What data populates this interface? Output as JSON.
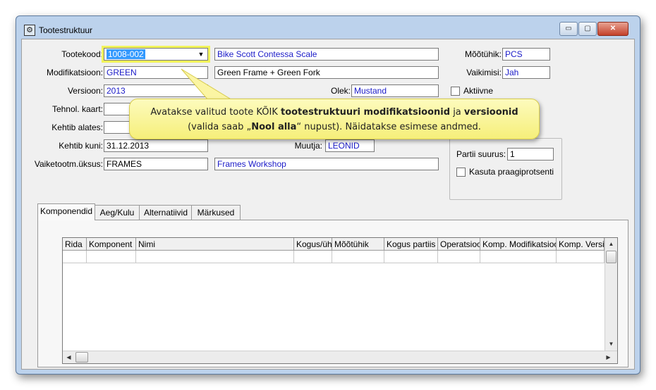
{
  "window": {
    "title": "Tootestruktuur",
    "buttons": {
      "minimize": "▭",
      "maximize": "▢",
      "close": "✕"
    }
  },
  "form": {
    "tootekood": {
      "label": "Tootekood:",
      "value": "1008-002",
      "description": "Bike Scott Contessa Scale"
    },
    "modifikatsioon": {
      "label": "Modifikatsioon:",
      "value": "GREEN",
      "description": "Green Frame + Green Fork"
    },
    "versioon": {
      "label": "Versioon:",
      "value": "2013"
    },
    "olek": {
      "label": "Olek:",
      "value": "Mustand"
    },
    "tehnol_kaart": {
      "label": "Tehnol. kaart:",
      "value": ""
    },
    "kehtib_alates": {
      "label": "Kehtib alates:",
      "value": ""
    },
    "kehtib_kuni": {
      "label": "Kehtib kuni:",
      "value": "31.12.2013"
    },
    "muutja": {
      "label": "Muutja:",
      "value": "LEONID"
    },
    "vaiketootm_uksus": {
      "label": "Vaiketootm.üksus:",
      "value": "FRAMES",
      "description": "Frames Workshop"
    },
    "mootuhik": {
      "label": "Mõõtühik:",
      "value": "PCS"
    },
    "vaikimisi": {
      "label": "Vaikimisi:",
      "value": "Jah"
    },
    "aktiivne": {
      "label": "Aktiivne",
      "checked": false
    },
    "partii_suurus": {
      "label": "Partii suurus:",
      "value": "1"
    },
    "kasuta_praagiprotsenti": {
      "label": "Kasuta praagiprotsenti",
      "checked": false
    }
  },
  "callout": {
    "line1_a": "Avatakse valitud toote KÕIK ",
    "line1_b": "tootestruktuuri modifikatsioonid",
    "line1_c": " ja ",
    "line1_d": "versioonid",
    "line2_a": "(valida saab  „",
    "line2_b": "Nool alla",
    "line2_c": "“ nupust). Näidatakse esimese andmed."
  },
  "tabs": [
    "Komponendid",
    "Aeg/Kulu",
    "Alternatiivid",
    "Märkused"
  ],
  "grid": {
    "columns": [
      "Rida",
      "Komponent",
      "Nimi",
      "Kogus/üh",
      "Mõõtühik",
      "Kogus partiis",
      "Operatsioo",
      "Komp. Modifikatsioo",
      "Komp. Versioon"
    ]
  },
  "icons": {
    "combo_arrow": "▼",
    "scroll_up": "▲",
    "scroll_down": "▼",
    "scroll_left": "◀",
    "scroll_right": "▶",
    "app": "⚙"
  },
  "colors": {
    "field_text_blue": "#1b1bc8",
    "selection": "#3399ff",
    "callout_fill": "#f6ef7a",
    "focus_highlight": "#f1f35a"
  }
}
